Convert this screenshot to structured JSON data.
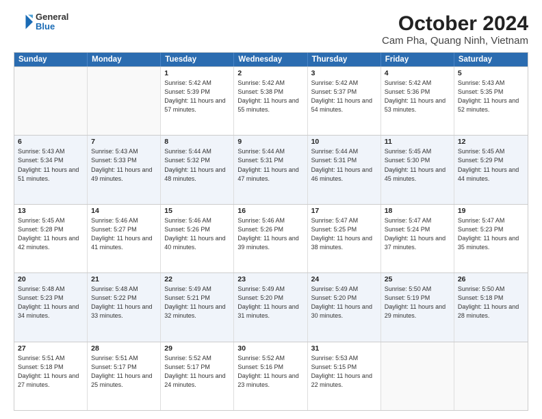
{
  "header": {
    "logo": {
      "general": "General",
      "blue": "Blue"
    },
    "title": "October 2024",
    "subtitle": "Cam Pha, Quang Ninh, Vietnam"
  },
  "calendar": {
    "weekdays": [
      "Sunday",
      "Monday",
      "Tuesday",
      "Wednesday",
      "Thursday",
      "Friday",
      "Saturday"
    ],
    "weeks": [
      [
        {
          "day": "",
          "sunrise": "",
          "sunset": "",
          "daylight": "",
          "empty": true
        },
        {
          "day": "",
          "sunrise": "",
          "sunset": "",
          "daylight": "",
          "empty": true
        },
        {
          "day": "1",
          "sunrise": "Sunrise: 5:42 AM",
          "sunset": "Sunset: 5:39 PM",
          "daylight": "Daylight: 11 hours and 57 minutes."
        },
        {
          "day": "2",
          "sunrise": "Sunrise: 5:42 AM",
          "sunset": "Sunset: 5:38 PM",
          "daylight": "Daylight: 11 hours and 55 minutes."
        },
        {
          "day": "3",
          "sunrise": "Sunrise: 5:42 AM",
          "sunset": "Sunset: 5:37 PM",
          "daylight": "Daylight: 11 hours and 54 minutes."
        },
        {
          "day": "4",
          "sunrise": "Sunrise: 5:42 AM",
          "sunset": "Sunset: 5:36 PM",
          "daylight": "Daylight: 11 hours and 53 minutes."
        },
        {
          "day": "5",
          "sunrise": "Sunrise: 5:43 AM",
          "sunset": "Sunset: 5:35 PM",
          "daylight": "Daylight: 11 hours and 52 minutes."
        }
      ],
      [
        {
          "day": "6",
          "sunrise": "Sunrise: 5:43 AM",
          "sunset": "Sunset: 5:34 PM",
          "daylight": "Daylight: 11 hours and 51 minutes."
        },
        {
          "day": "7",
          "sunrise": "Sunrise: 5:43 AM",
          "sunset": "Sunset: 5:33 PM",
          "daylight": "Daylight: 11 hours and 49 minutes."
        },
        {
          "day": "8",
          "sunrise": "Sunrise: 5:44 AM",
          "sunset": "Sunset: 5:32 PM",
          "daylight": "Daylight: 11 hours and 48 minutes."
        },
        {
          "day": "9",
          "sunrise": "Sunrise: 5:44 AM",
          "sunset": "Sunset: 5:31 PM",
          "daylight": "Daylight: 11 hours and 47 minutes."
        },
        {
          "day": "10",
          "sunrise": "Sunrise: 5:44 AM",
          "sunset": "Sunset: 5:31 PM",
          "daylight": "Daylight: 11 hours and 46 minutes."
        },
        {
          "day": "11",
          "sunrise": "Sunrise: 5:45 AM",
          "sunset": "Sunset: 5:30 PM",
          "daylight": "Daylight: 11 hours and 45 minutes."
        },
        {
          "day": "12",
          "sunrise": "Sunrise: 5:45 AM",
          "sunset": "Sunset: 5:29 PM",
          "daylight": "Daylight: 11 hours and 44 minutes."
        }
      ],
      [
        {
          "day": "13",
          "sunrise": "Sunrise: 5:45 AM",
          "sunset": "Sunset: 5:28 PM",
          "daylight": "Daylight: 11 hours and 42 minutes."
        },
        {
          "day": "14",
          "sunrise": "Sunrise: 5:46 AM",
          "sunset": "Sunset: 5:27 PM",
          "daylight": "Daylight: 11 hours and 41 minutes."
        },
        {
          "day": "15",
          "sunrise": "Sunrise: 5:46 AM",
          "sunset": "Sunset: 5:26 PM",
          "daylight": "Daylight: 11 hours and 40 minutes."
        },
        {
          "day": "16",
          "sunrise": "Sunrise: 5:46 AM",
          "sunset": "Sunset: 5:26 PM",
          "daylight": "Daylight: 11 hours and 39 minutes."
        },
        {
          "day": "17",
          "sunrise": "Sunrise: 5:47 AM",
          "sunset": "Sunset: 5:25 PM",
          "daylight": "Daylight: 11 hours and 38 minutes."
        },
        {
          "day": "18",
          "sunrise": "Sunrise: 5:47 AM",
          "sunset": "Sunset: 5:24 PM",
          "daylight": "Daylight: 11 hours and 37 minutes."
        },
        {
          "day": "19",
          "sunrise": "Sunrise: 5:47 AM",
          "sunset": "Sunset: 5:23 PM",
          "daylight": "Daylight: 11 hours and 35 minutes."
        }
      ],
      [
        {
          "day": "20",
          "sunrise": "Sunrise: 5:48 AM",
          "sunset": "Sunset: 5:23 PM",
          "daylight": "Daylight: 11 hours and 34 minutes."
        },
        {
          "day": "21",
          "sunrise": "Sunrise: 5:48 AM",
          "sunset": "Sunset: 5:22 PM",
          "daylight": "Daylight: 11 hours and 33 minutes."
        },
        {
          "day": "22",
          "sunrise": "Sunrise: 5:49 AM",
          "sunset": "Sunset: 5:21 PM",
          "daylight": "Daylight: 11 hours and 32 minutes."
        },
        {
          "day": "23",
          "sunrise": "Sunrise: 5:49 AM",
          "sunset": "Sunset: 5:20 PM",
          "daylight": "Daylight: 11 hours and 31 minutes."
        },
        {
          "day": "24",
          "sunrise": "Sunrise: 5:49 AM",
          "sunset": "Sunset: 5:20 PM",
          "daylight": "Daylight: 11 hours and 30 minutes."
        },
        {
          "day": "25",
          "sunrise": "Sunrise: 5:50 AM",
          "sunset": "Sunset: 5:19 PM",
          "daylight": "Daylight: 11 hours and 29 minutes."
        },
        {
          "day": "26",
          "sunrise": "Sunrise: 5:50 AM",
          "sunset": "Sunset: 5:18 PM",
          "daylight": "Daylight: 11 hours and 28 minutes."
        }
      ],
      [
        {
          "day": "27",
          "sunrise": "Sunrise: 5:51 AM",
          "sunset": "Sunset: 5:18 PM",
          "daylight": "Daylight: 11 hours and 27 minutes."
        },
        {
          "day": "28",
          "sunrise": "Sunrise: 5:51 AM",
          "sunset": "Sunset: 5:17 PM",
          "daylight": "Daylight: 11 hours and 25 minutes."
        },
        {
          "day": "29",
          "sunrise": "Sunrise: 5:52 AM",
          "sunset": "Sunset: 5:17 PM",
          "daylight": "Daylight: 11 hours and 24 minutes."
        },
        {
          "day": "30",
          "sunrise": "Sunrise: 5:52 AM",
          "sunset": "Sunset: 5:16 PM",
          "daylight": "Daylight: 11 hours and 23 minutes."
        },
        {
          "day": "31",
          "sunrise": "Sunrise: 5:53 AM",
          "sunset": "Sunset: 5:15 PM",
          "daylight": "Daylight: 11 hours and 22 minutes."
        },
        {
          "day": "",
          "sunrise": "",
          "sunset": "",
          "daylight": "",
          "empty": true
        },
        {
          "day": "",
          "sunrise": "",
          "sunset": "",
          "daylight": "",
          "empty": true
        }
      ]
    ]
  }
}
